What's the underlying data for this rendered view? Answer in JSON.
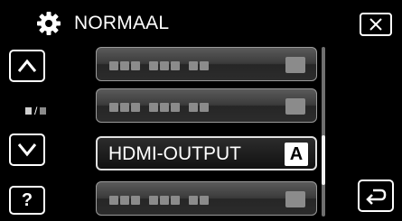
{
  "header": {
    "title": "NORMAAL",
    "icon": "gear-icon"
  },
  "nav": {
    "up_icon": "chevron-up-icon",
    "down_icon": "chevron-down-icon",
    "help_label": "?",
    "close_icon": "close-icon",
    "back_icon": "return-icon"
  },
  "menu": {
    "items": [
      {
        "label": "",
        "state": "inactive"
      },
      {
        "label": "",
        "state": "inactive"
      },
      {
        "label": "HDMI-OUTPUT",
        "value": "A",
        "state": "selected"
      },
      {
        "label": "",
        "state": "inactive"
      }
    ]
  },
  "colors": {
    "background": "#000000",
    "button_border": "#ffffff",
    "inactive_item": "#3b3b3b",
    "placeholder": "#8b8b8b"
  }
}
